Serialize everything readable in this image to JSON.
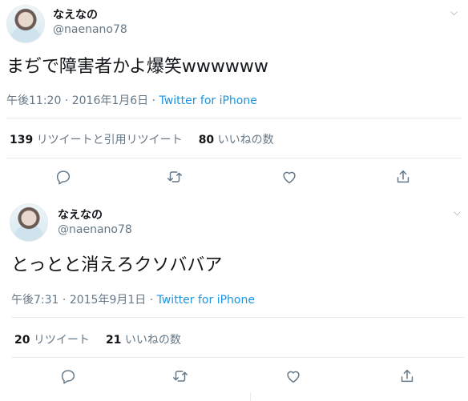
{
  "tweets": [
    {
      "display_name": "なえなの",
      "handle": "@naenano78",
      "text": "まぢで障害者かよ爆笑wwwwww",
      "time": "午後11:20",
      "date": "2016年1月6日",
      "source": "Twitter for iPhone",
      "retweet_count": "139",
      "retweet_label": "リツイートと引用リツイート",
      "like_count": "80",
      "like_label": "いいねの数"
    },
    {
      "display_name": "なえなの",
      "handle": "@naenano78",
      "text": "とっとと消えろクソババア",
      "time": "午後7:31",
      "date": "2015年9月1日",
      "source": "Twitter for iPhone",
      "retweet_count": "20",
      "retweet_label": "リツイート",
      "like_count": "21",
      "like_label": "いいねの数"
    }
  ],
  "meta_separator": "·",
  "icons": [
    "reply-icon",
    "retweet-icon",
    "like-icon",
    "share-icon",
    "chevron-down-icon"
  ],
  "colors": {
    "link": "#1b95e0",
    "secondary": "#657786",
    "rule": "#e6ecf0"
  }
}
